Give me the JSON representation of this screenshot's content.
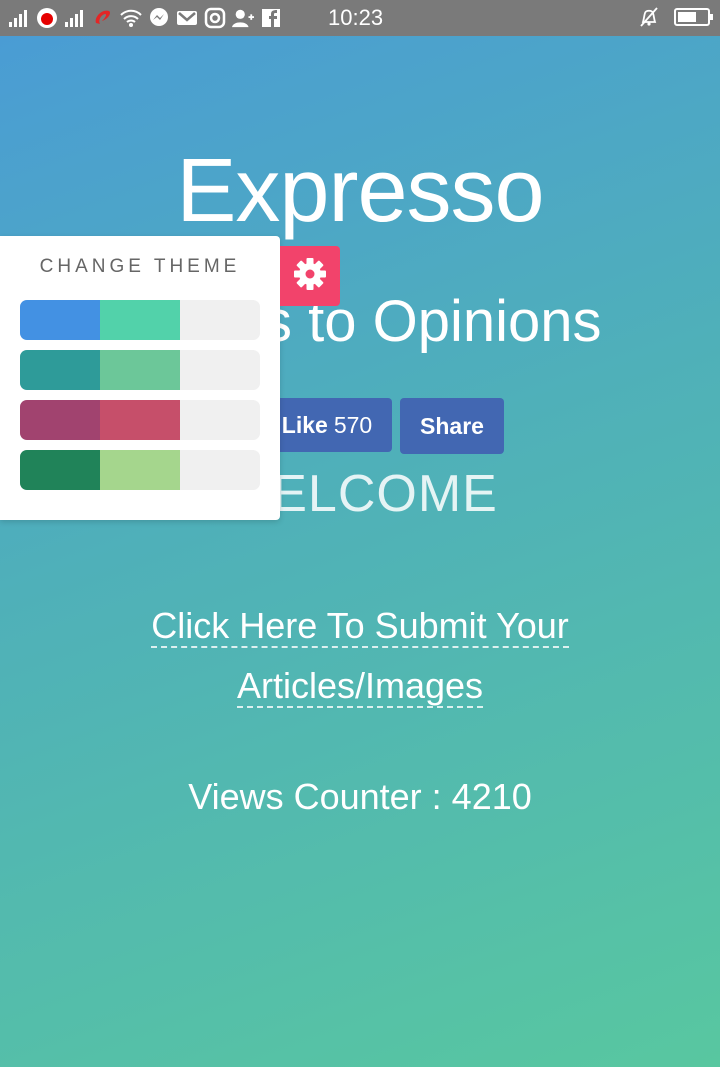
{
  "status_bar": {
    "time": "10:23",
    "battery_level": 0.65,
    "icons": [
      "signal-icon",
      "vodafone-icon",
      "signal-icon",
      "airtel-icon",
      "wifi-icon",
      "messenger-icon",
      "gmail-icon",
      "instagram-icon",
      "add-user-icon",
      "facebook-icon"
    ],
    "right_icons": [
      "bell-off-icon",
      "battery-icon"
    ]
  },
  "header": {
    "title": "Expresso",
    "subtitle": "ons to Opinions"
  },
  "social": {
    "like_label": "Like",
    "like_count": "570",
    "share_label": "Share"
  },
  "main": {
    "welcome": "WELCOME",
    "submit_line1": "Click Here To Submit Your",
    "submit_line2": "Articles/Images",
    "views": "Views Counter : 4210"
  },
  "theme_panel": {
    "heading": "CHANGE THEME",
    "themes": [
      {
        "primary": "#4391e3",
        "secondary": "#52d2aa"
      },
      {
        "primary": "#2e9b99",
        "secondary": "#6cc799"
      },
      {
        "primary": "#a1436f",
        "secondary": "#c64f6a"
      },
      {
        "primary": "#208359",
        "secondary": "#a5d68d"
      }
    ],
    "toggle_icon": "gear-icon",
    "toggle_color": "#f2436b"
  }
}
